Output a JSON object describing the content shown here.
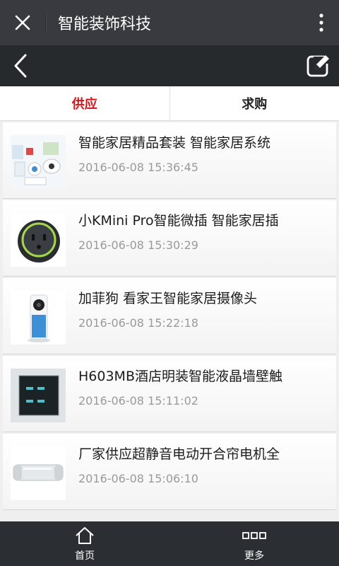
{
  "topbar": {
    "title": "智能装饰科技",
    "close_icon": "close-icon",
    "more_icon": "more-vertical-icon"
  },
  "navbar": {
    "back_icon": "chevron-left-icon",
    "edit_icon": "edit-icon"
  },
  "tabs": [
    {
      "label": "供应",
      "active": true
    },
    {
      "label": "求购",
      "active": false
    }
  ],
  "items": [
    {
      "title": "智能家居精品套装 智能家居系统",
      "date": "2016-06-08 15:36:45",
      "thumb": "smart-home-kit-image"
    },
    {
      "title": "小KMini Pro智能微插 智能家居插",
      "date": "2016-06-08 15:30:29",
      "thumb": "smart-plug-image"
    },
    {
      "title": "加菲狗 看家王智能家居摄像头",
      "date": "2016-06-08 15:22:18",
      "thumb": "camera-image"
    },
    {
      "title": "H603MB酒店明装智能液晶墙壁触",
      "date": "2016-06-08 15:11:02",
      "thumb": "wall-switch-image"
    },
    {
      "title": "厂家供应超静音电动开合帘电机全",
      "date": "2016-06-08 15:06:10",
      "thumb": "curtain-motor-image"
    }
  ],
  "bottombar": {
    "home_label": "首页",
    "more_label": "更多",
    "home_icon": "home-icon",
    "more_icon": "grid-icon"
  },
  "colors": {
    "topbar_bg": "#393a3f",
    "navbar_bg": "#262a2d",
    "active_tab": "#d0141c",
    "bottombar_bg": "#2b2f33"
  }
}
